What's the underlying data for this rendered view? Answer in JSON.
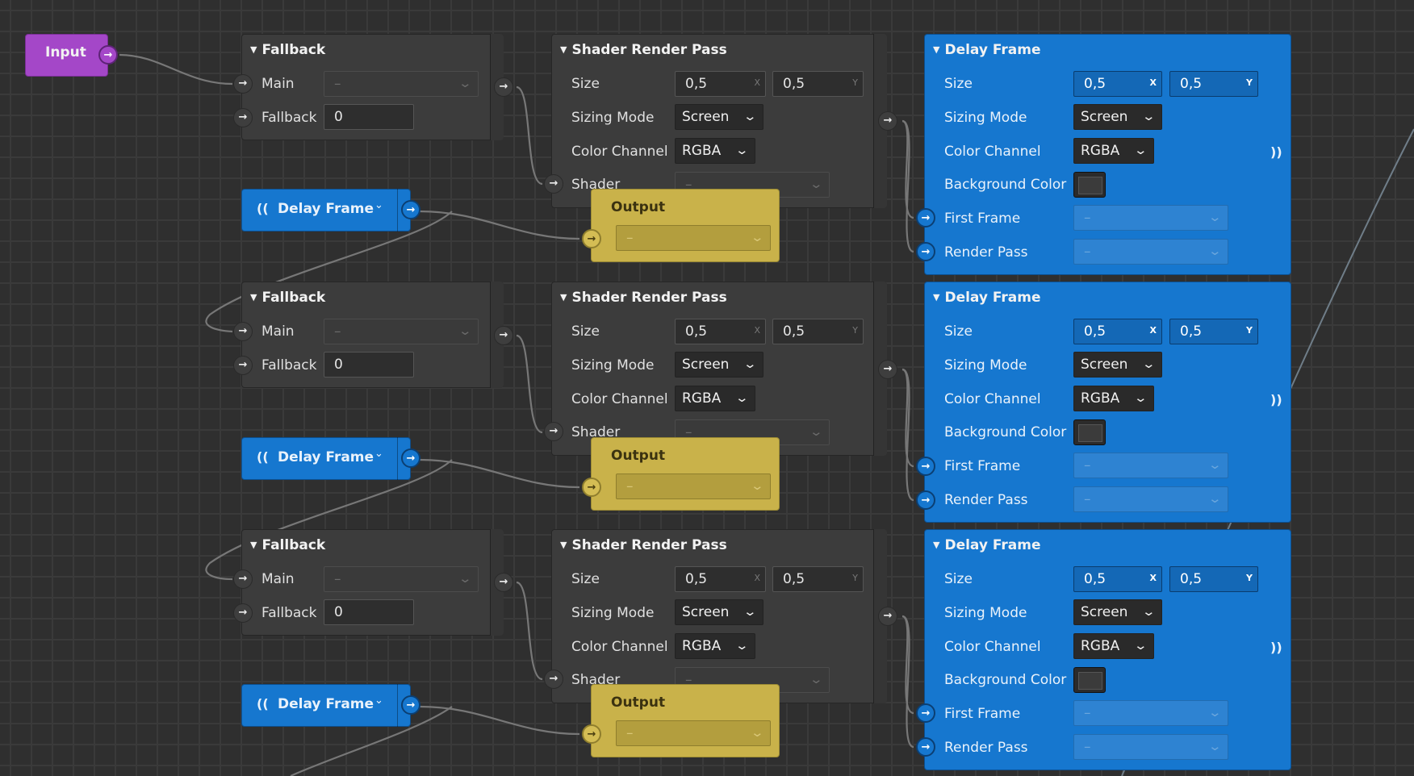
{
  "colors": {
    "canvas": "#2f2f2f",
    "node_gray": "#3c3c3c",
    "node_blue": "#1677cf",
    "node_yellow": "#c9b24a",
    "node_purple": "#a447c8",
    "wire": "#777777"
  },
  "input_node": {
    "title": "Input"
  },
  "icons": {
    "expand_caret": "▼",
    "dropdown_chevron": "⌄",
    "port_arrow": "→",
    "signal": "))",
    "signal_left": "(("
  },
  "fallback": {
    "title": "Fallback",
    "main_label": "Main",
    "main_value": "–",
    "fallback_label": "Fallback",
    "fallback_value": "0"
  },
  "delay_pill": {
    "label": "Delay Frame"
  },
  "shader": {
    "title": "Shader Render Pass",
    "size_label": "Size",
    "size_x": "0,5",
    "size_y": "0,5",
    "x_axis": "X",
    "y_axis": "Y",
    "sizing_mode_label": "Sizing Mode",
    "sizing_mode_value": "Screen",
    "color_channel_label": "Color Channel",
    "color_channel_value": "RGBA",
    "shader_label": "Shader",
    "shader_value": "–"
  },
  "output": {
    "title": "Output",
    "value": "–"
  },
  "delay": {
    "title": "Delay Frame",
    "size_label": "Size",
    "size_x": "0,5",
    "size_y": "0,5",
    "x_axis": "X",
    "y_axis": "Y",
    "sizing_mode_label": "Sizing Mode",
    "sizing_mode_value": "Screen",
    "color_channel_label": "Color Channel",
    "color_channel_value": "RGBA",
    "background_color_label": "Background Color",
    "first_frame_label": "First Frame",
    "first_frame_value": "–",
    "render_pass_label": "Render Pass",
    "render_pass_value": "–"
  }
}
